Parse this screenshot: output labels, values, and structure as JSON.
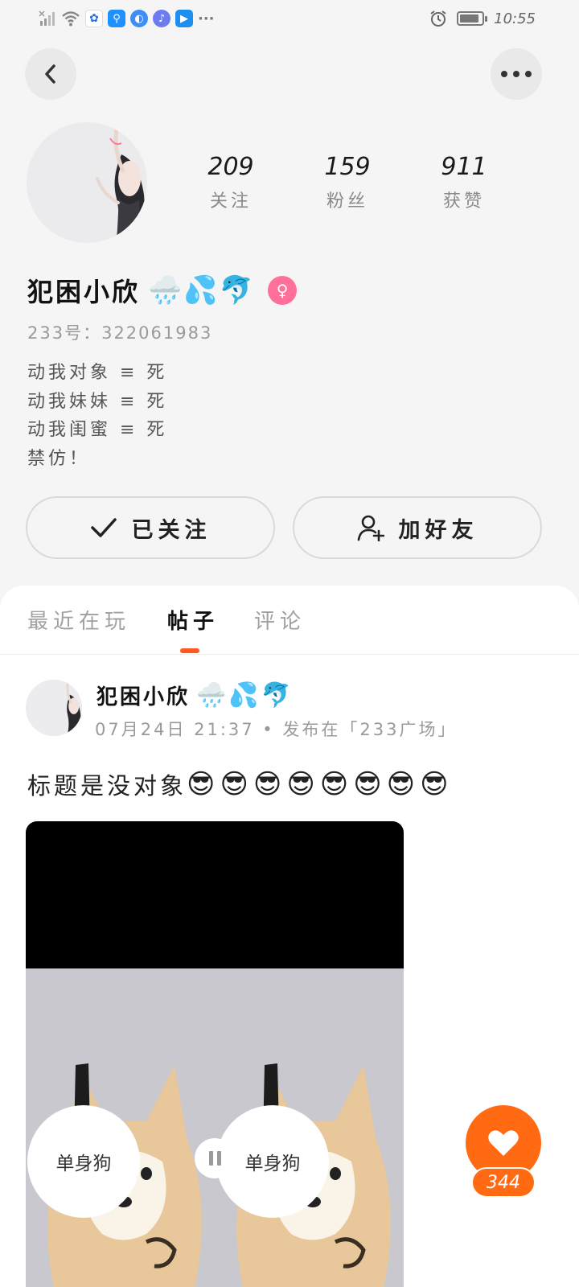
{
  "status_bar": {
    "time": "10:55",
    "icons": [
      "signal-off-icon",
      "wifi-icon",
      "app-badge-icon",
      "search-app-icon",
      "browser-icon",
      "music-icon",
      "store-icon",
      "more-dots-icon",
      "alarm-icon",
      "battery-icon"
    ],
    "more": "···"
  },
  "header": {
    "back_icon": "chevron-left-icon",
    "more_icon": "more-horizontal-icon"
  },
  "profile": {
    "stats": [
      {
        "value": "209",
        "label": "关注"
      },
      {
        "value": "159",
        "label": "粉丝"
      },
      {
        "value": "911",
        "label": "获赞"
      }
    ],
    "name": "犯困小欣",
    "name_emoji": "🌧️💦🐬",
    "gender_symbol": "♀",
    "uid_text": "233号：322061983",
    "bio_lines": [
      "动我对象 ≡ 死",
      "动我妹妹 ≡ 死",
      "动我闺蜜 ≡ 死",
      "禁仿！"
    ]
  },
  "actions": {
    "follow_label": "已关注",
    "friend_label": "加好友"
  },
  "tabs": [
    "最近在玩",
    "帖子",
    "评论"
  ],
  "active_tab": "帖子",
  "post": {
    "author": "犯困小欣",
    "author_emoji": "🌧️💦🐬",
    "meta": "07月24日 21:37 • 发布在「233广场」",
    "title": "标题是没对象",
    "title_emoji": "😎😎😎😎😎😎😎😎",
    "media_labels": [
      "单身狗",
      "单身狗"
    ]
  },
  "like": {
    "count": "344"
  },
  "colors": {
    "accent": "#ff6a13",
    "gender_badge": "#ff6f9a",
    "tab_indicator": "#ff5a1f"
  }
}
